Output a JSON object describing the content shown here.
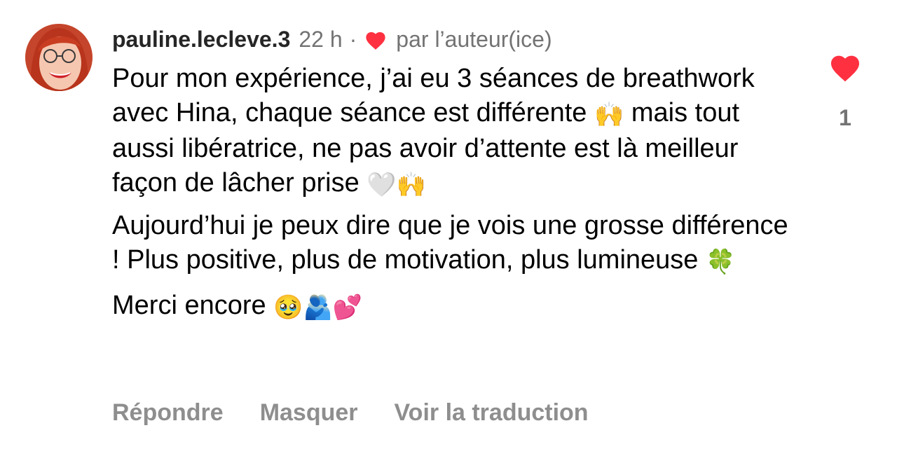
{
  "comment": {
    "username": "pauline.lecleve.3",
    "time": "22 h",
    "separator": "·",
    "liked_by_author": "par l’auteur(ice)",
    "paragraphs": [
      {
        "segments": [
          {
            "type": "text",
            "value": "Pour mon expérience, j’ai eu 3 séances de breathwork avec Hina, chaque séance est différente "
          },
          {
            "type": "emoji",
            "icon": "raising-hands-icon",
            "glyph": "🙌"
          },
          {
            "type": "text",
            "value": " mais tout aussi libératrice, ne pas avoir d’attente est là meilleur façon de lâcher prise "
          },
          {
            "type": "emoji",
            "icon": "white-heart-icon",
            "glyph": "🤍"
          },
          {
            "type": "emoji",
            "icon": "raising-hands-icon",
            "glyph": "🙌"
          }
        ]
      },
      {
        "segments": [
          {
            "type": "text",
            "value": "Aujourd’hui je peux dire que je vois une grosse différence ! Plus positive, plus de motivation, plus lumineuse "
          },
          {
            "type": "emoji",
            "icon": "four-leaf-clover-icon",
            "glyph": "🍀"
          }
        ]
      },
      {
        "segments": [
          {
            "type": "text",
            "value": "Merci encore "
          },
          {
            "type": "emoji",
            "icon": "pleading-face-icon",
            "glyph": "🥹"
          },
          {
            "type": "emoji",
            "icon": "hugging-people-icon",
            "glyph": "🫂"
          },
          {
            "type": "emoji",
            "icon": "two-hearts-icon",
            "glyph": "💕"
          }
        ]
      }
    ],
    "actions": {
      "reply": "Répondre",
      "hide": "Masquer",
      "translate": "Voir la traduction"
    },
    "likes": {
      "count": "1",
      "icon": "heart-icon",
      "liked": true
    }
  },
  "colors": {
    "heart": "#ff3040",
    "meta_gray": "#737373",
    "action_gray": "#8e8e8e"
  }
}
